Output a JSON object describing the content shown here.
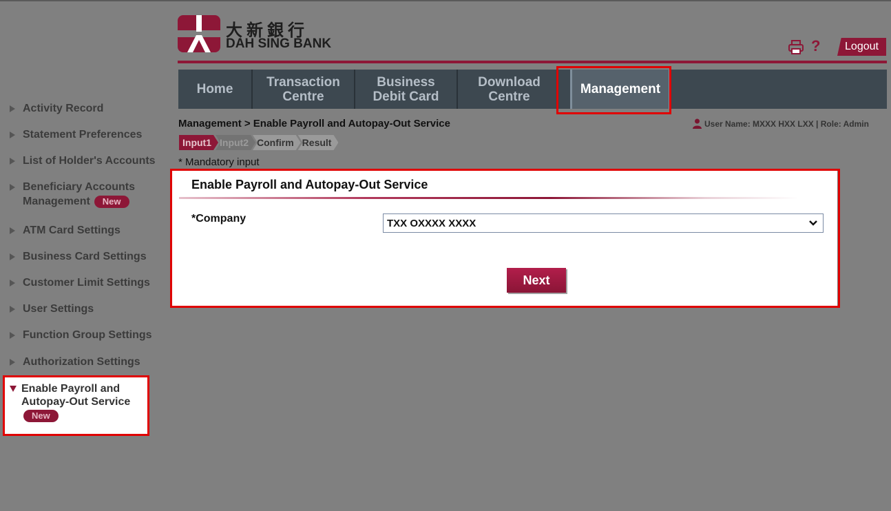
{
  "brand": {
    "chinese_name": "大新銀行",
    "english_name": "DAH SING BANK",
    "color": "#8d1737"
  },
  "header": {
    "print_icon": "printer-icon",
    "help_label": "?",
    "logout_label": "Logout"
  },
  "nav": {
    "items": [
      {
        "label": "Home"
      },
      {
        "label": "Transaction\nCentre"
      },
      {
        "label": "Business\nDebit Card"
      },
      {
        "label": "Download\nCentre"
      },
      {
        "label": "Management"
      }
    ],
    "active_index": 4
  },
  "breadcrumb": "Management > Enable Payroll and Autopay-Out Service",
  "user_info": "User Name: MXXX HXX LXX | Role: Admin",
  "steps": [
    "Input1",
    "Input2",
    "Confirm",
    "Result"
  ],
  "mandatory_note": "* Mandatory input",
  "form": {
    "title": "Enable Payroll and Autopay-Out Service",
    "company_label": "*Company",
    "company_value": "TXX OXXXX XXXX",
    "next_label": "Next"
  },
  "sidebar": {
    "items": [
      {
        "label": "Activity Record"
      },
      {
        "label": "Statement Preferences"
      },
      {
        "label": "List of Holder's Accounts"
      },
      {
        "label": "Beneficiary Accounts Management",
        "badge": "New"
      },
      {
        "label": "ATM Card Settings"
      },
      {
        "label": "Business Card Settings"
      },
      {
        "label": "Customer Limit Settings"
      },
      {
        "label": "User Settings"
      },
      {
        "label": "Function Group Settings"
      },
      {
        "label": "Authorization Settings"
      }
    ],
    "active": {
      "label": "Enable Payroll and Autopay-Out Service",
      "badge": "New"
    }
  }
}
